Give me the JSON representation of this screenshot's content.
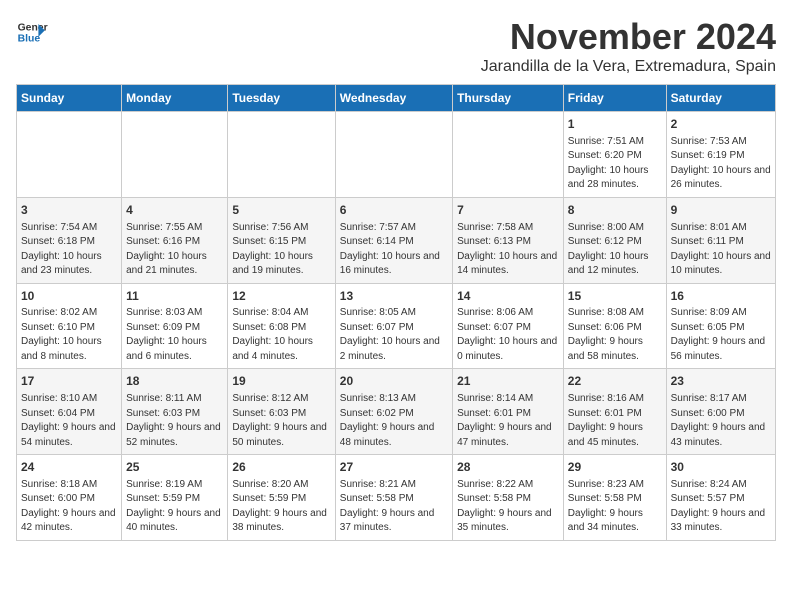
{
  "logo": {
    "line1": "General",
    "line2": "Blue"
  },
  "title": "November 2024",
  "location": "Jarandilla de la Vera, Extremadura, Spain",
  "weekdays": [
    "Sunday",
    "Monday",
    "Tuesday",
    "Wednesday",
    "Thursday",
    "Friday",
    "Saturday"
  ],
  "weeks": [
    [
      {
        "day": "",
        "info": ""
      },
      {
        "day": "",
        "info": ""
      },
      {
        "day": "",
        "info": ""
      },
      {
        "day": "",
        "info": ""
      },
      {
        "day": "",
        "info": ""
      },
      {
        "day": "1",
        "info": "Sunrise: 7:51 AM\nSunset: 6:20 PM\nDaylight: 10 hours and 28 minutes."
      },
      {
        "day": "2",
        "info": "Sunrise: 7:53 AM\nSunset: 6:19 PM\nDaylight: 10 hours and 26 minutes."
      }
    ],
    [
      {
        "day": "3",
        "info": "Sunrise: 7:54 AM\nSunset: 6:18 PM\nDaylight: 10 hours and 23 minutes."
      },
      {
        "day": "4",
        "info": "Sunrise: 7:55 AM\nSunset: 6:16 PM\nDaylight: 10 hours and 21 minutes."
      },
      {
        "day": "5",
        "info": "Sunrise: 7:56 AM\nSunset: 6:15 PM\nDaylight: 10 hours and 19 minutes."
      },
      {
        "day": "6",
        "info": "Sunrise: 7:57 AM\nSunset: 6:14 PM\nDaylight: 10 hours and 16 minutes."
      },
      {
        "day": "7",
        "info": "Sunrise: 7:58 AM\nSunset: 6:13 PM\nDaylight: 10 hours and 14 minutes."
      },
      {
        "day": "8",
        "info": "Sunrise: 8:00 AM\nSunset: 6:12 PM\nDaylight: 10 hours and 12 minutes."
      },
      {
        "day": "9",
        "info": "Sunrise: 8:01 AM\nSunset: 6:11 PM\nDaylight: 10 hours and 10 minutes."
      }
    ],
    [
      {
        "day": "10",
        "info": "Sunrise: 8:02 AM\nSunset: 6:10 PM\nDaylight: 10 hours and 8 minutes."
      },
      {
        "day": "11",
        "info": "Sunrise: 8:03 AM\nSunset: 6:09 PM\nDaylight: 10 hours and 6 minutes."
      },
      {
        "day": "12",
        "info": "Sunrise: 8:04 AM\nSunset: 6:08 PM\nDaylight: 10 hours and 4 minutes."
      },
      {
        "day": "13",
        "info": "Sunrise: 8:05 AM\nSunset: 6:07 PM\nDaylight: 10 hours and 2 minutes."
      },
      {
        "day": "14",
        "info": "Sunrise: 8:06 AM\nSunset: 6:07 PM\nDaylight: 10 hours and 0 minutes."
      },
      {
        "day": "15",
        "info": "Sunrise: 8:08 AM\nSunset: 6:06 PM\nDaylight: 9 hours and 58 minutes."
      },
      {
        "day": "16",
        "info": "Sunrise: 8:09 AM\nSunset: 6:05 PM\nDaylight: 9 hours and 56 minutes."
      }
    ],
    [
      {
        "day": "17",
        "info": "Sunrise: 8:10 AM\nSunset: 6:04 PM\nDaylight: 9 hours and 54 minutes."
      },
      {
        "day": "18",
        "info": "Sunrise: 8:11 AM\nSunset: 6:03 PM\nDaylight: 9 hours and 52 minutes."
      },
      {
        "day": "19",
        "info": "Sunrise: 8:12 AM\nSunset: 6:03 PM\nDaylight: 9 hours and 50 minutes."
      },
      {
        "day": "20",
        "info": "Sunrise: 8:13 AM\nSunset: 6:02 PM\nDaylight: 9 hours and 48 minutes."
      },
      {
        "day": "21",
        "info": "Sunrise: 8:14 AM\nSunset: 6:01 PM\nDaylight: 9 hours and 47 minutes."
      },
      {
        "day": "22",
        "info": "Sunrise: 8:16 AM\nSunset: 6:01 PM\nDaylight: 9 hours and 45 minutes."
      },
      {
        "day": "23",
        "info": "Sunrise: 8:17 AM\nSunset: 6:00 PM\nDaylight: 9 hours and 43 minutes."
      }
    ],
    [
      {
        "day": "24",
        "info": "Sunrise: 8:18 AM\nSunset: 6:00 PM\nDaylight: 9 hours and 42 minutes."
      },
      {
        "day": "25",
        "info": "Sunrise: 8:19 AM\nSunset: 5:59 PM\nDaylight: 9 hours and 40 minutes."
      },
      {
        "day": "26",
        "info": "Sunrise: 8:20 AM\nSunset: 5:59 PM\nDaylight: 9 hours and 38 minutes."
      },
      {
        "day": "27",
        "info": "Sunrise: 8:21 AM\nSunset: 5:58 PM\nDaylight: 9 hours and 37 minutes."
      },
      {
        "day": "28",
        "info": "Sunrise: 8:22 AM\nSunset: 5:58 PM\nDaylight: 9 hours and 35 minutes."
      },
      {
        "day": "29",
        "info": "Sunrise: 8:23 AM\nSunset: 5:58 PM\nDaylight: 9 hours and 34 minutes."
      },
      {
        "day": "30",
        "info": "Sunrise: 8:24 AM\nSunset: 5:57 PM\nDaylight: 9 hours and 33 minutes."
      }
    ]
  ]
}
